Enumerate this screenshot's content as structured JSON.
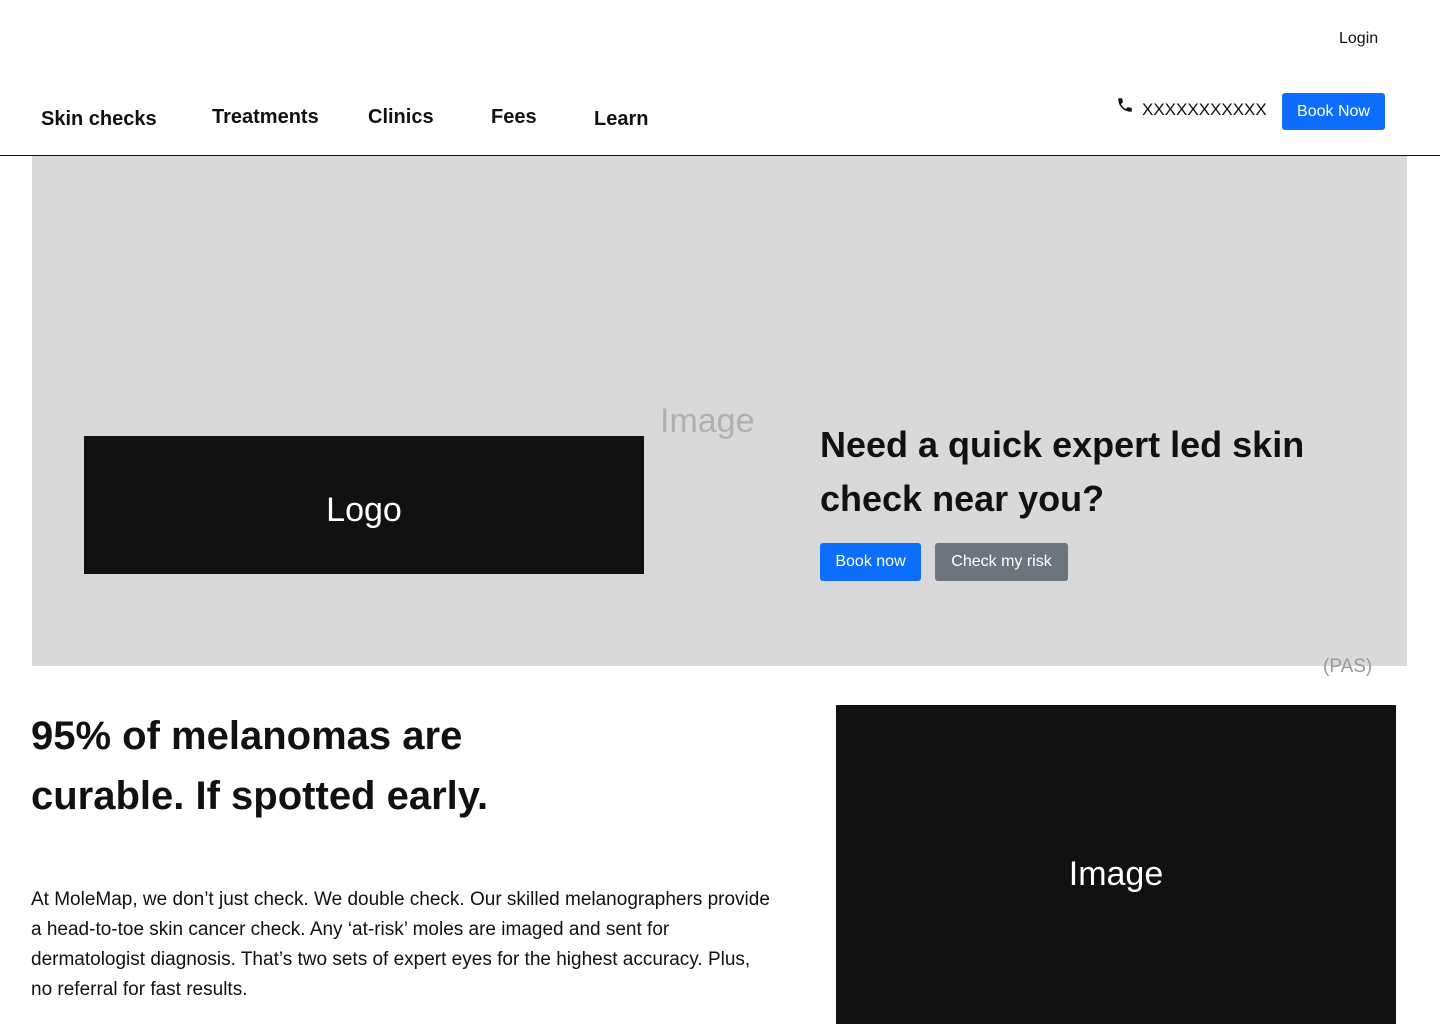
{
  "header": {
    "login_label": "Login",
    "phone_icon": "phone-icon",
    "phone_number": "XXXXXXXXXXX",
    "book_label": "Book Now"
  },
  "nav": {
    "items": [
      {
        "label": "Skin checks"
      },
      {
        "label": "Treatments"
      },
      {
        "label": "Clinics"
      },
      {
        "label": "Fees"
      },
      {
        "label": "Learn"
      }
    ]
  },
  "hero": {
    "image_label": "Image",
    "logo_label": "Logo",
    "heading": "Need a quick expert led skin check near you?",
    "book_button": "Book now",
    "risk_button": "Check my risk"
  },
  "pas_label": "(PAS)",
  "content": {
    "heading": "95% of melanomas are curable. If spotted early.",
    "body": "At MoleMap, we don’t just check. We double check. Our skilled melanographers provide a head-to-toe skin cancer check. Any ‘at-risk’ moles are imaged and sent for dermatologist diagnosis. That’s two sets of expert eyes for the highest accuracy. Plus, no referral for fast results.",
    "image_label": "Image"
  },
  "colors": {
    "primary": "#0d6efd",
    "secondary": "#6c757d",
    "hero_bg": "#d9d9d9",
    "placeholder_dark": "#111111"
  }
}
